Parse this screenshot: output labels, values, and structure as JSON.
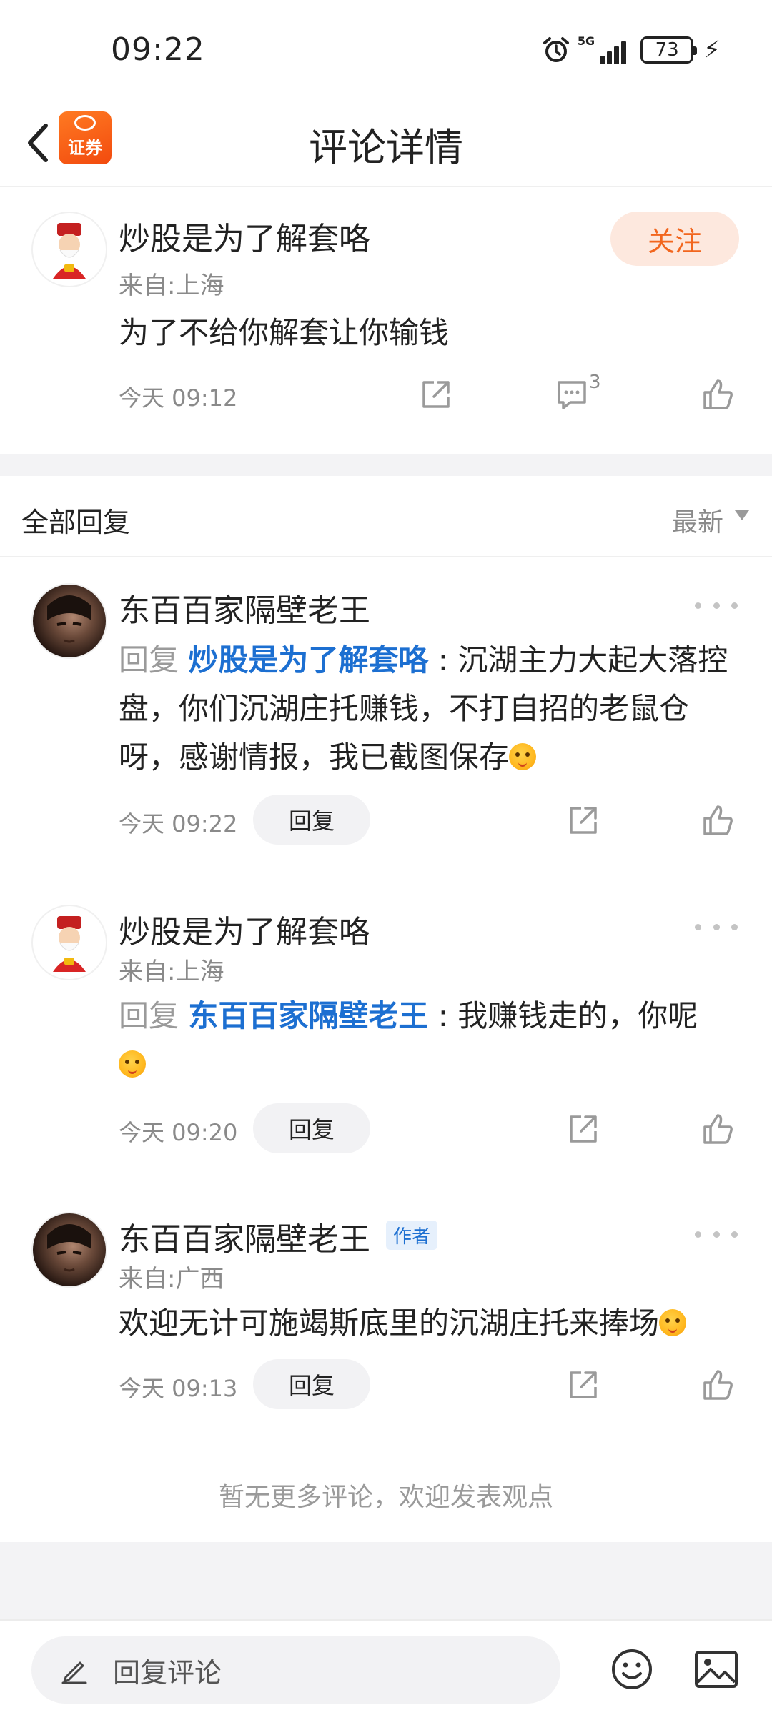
{
  "status_bar": {
    "time": "09:22",
    "network": "5G",
    "battery": "73"
  },
  "header": {
    "title": "评论详情",
    "app_logo_text": "证券"
  },
  "main_comment": {
    "username": "炒股是为了解套咯",
    "from": "来自:上海",
    "follow_label": "关注",
    "content": "为了不给你解套让你输钱",
    "time": "今天 09:12",
    "comment_count": "3"
  },
  "replies_header": {
    "title": "全部回复",
    "sort": "最新"
  },
  "replies": [
    {
      "username": "东百百家隔壁老王",
      "reply_prefix": "回复 ",
      "mention": "炒股是为了解套咯",
      "separator": " : ",
      "text": "沉湖主力大起大落控盘，你们沉湖庄托赚钱，不打自招的老鼠仓呀，感谢情报，我已截图保存",
      "time": "今天 09:22",
      "reply_label": "回复"
    },
    {
      "username": "炒股是为了解套咯",
      "from": "来自:上海",
      "reply_prefix": "回复 ",
      "mention": "东百百家隔壁老王",
      "separator": " : ",
      "text": "我赚钱走的，你呢",
      "time": "今天 09:20",
      "reply_label": "回复"
    },
    {
      "username": "东百百家隔壁老王",
      "author_tag": "作者",
      "from": "来自:广西",
      "text": "欢迎无计可施竭斯底里的沉湖庄托来捧场",
      "time": "今天 09:13",
      "reply_label": "回复"
    }
  ],
  "footer": {
    "no_more": "暂无更多评论，欢迎发表观点"
  },
  "bottom_bar": {
    "placeholder": "回复评论"
  },
  "colors": {
    "accent_orange": "#f2661e",
    "follow_bg": "#fde8de",
    "mention_blue": "#1c6fd1"
  }
}
